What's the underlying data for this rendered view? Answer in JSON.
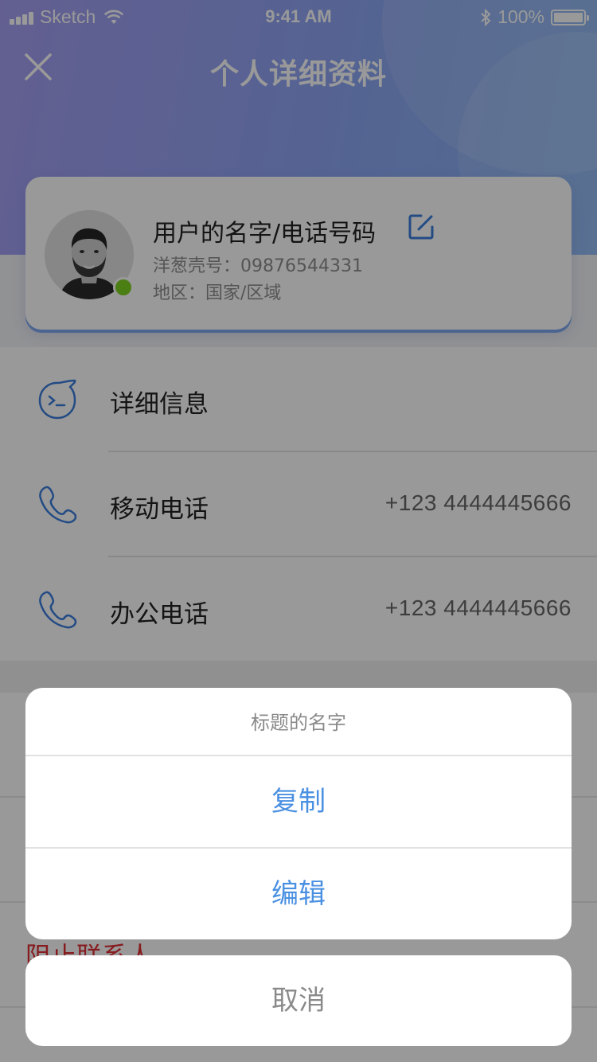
{
  "status_bar": {
    "carrier": "Sketch",
    "time": "9:41 AM",
    "battery_text": "100%"
  },
  "nav": {
    "title": "个人详细资料",
    "close_icon": "close-icon"
  },
  "profile": {
    "name": "用户的名字/电话号码",
    "id_line": "洋葱壳号：09876544331",
    "region_line": "地区：国家/区域",
    "online_color": "#7ed321",
    "edit_icon": "edit-icon"
  },
  "rows": [
    {
      "icon": "chat-bubble-icon",
      "label": "详细信息",
      "value": ""
    },
    {
      "icon": "phone-icon",
      "label": "移动电话",
      "value": "+123   4444445666"
    },
    {
      "icon": "phone-icon",
      "label": "办公电话",
      "value": "+123   4444445666"
    }
  ],
  "block_contact_label": "阻止联系人",
  "action_sheet": {
    "title": "标题的名字",
    "actions": [
      "复制",
      "编辑"
    ],
    "cancel": "取消",
    "action_color": "#4a90e2"
  },
  "colors": {
    "accent": "#4a90e2",
    "icon_blue": "#3b7ddd",
    "danger": "#e02f35"
  }
}
